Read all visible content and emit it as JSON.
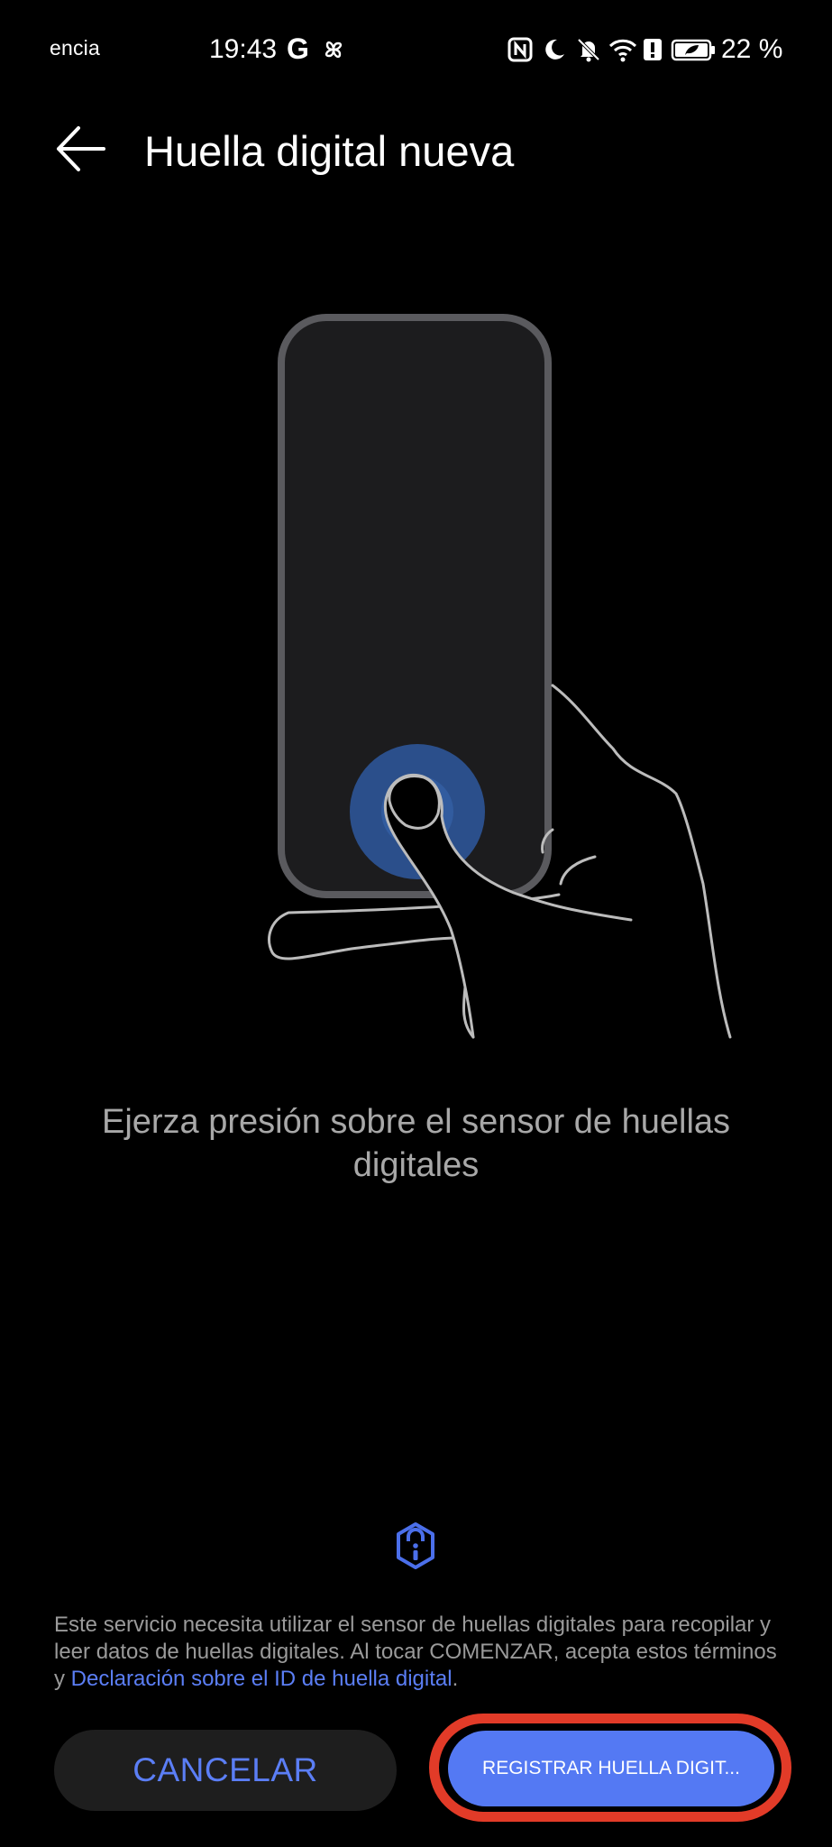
{
  "status_bar": {
    "left_text": "encia",
    "time": "19:43",
    "g_label": "G",
    "battery_percent": "22 %"
  },
  "header": {
    "title": "Huella digital nueva"
  },
  "instruction": {
    "text": "Ejerza presión sobre el sensor de huellas digitales"
  },
  "terms": {
    "text": "Este servicio necesita utilizar el sensor de huellas digitales para recopilar y leer datos de huellas digitales. Al tocar COMENZAR, acepta estos términos y ",
    "link_text": "Declaración sobre el ID de huella digital",
    "suffix": "."
  },
  "buttons": {
    "cancel_label": "CANCELAR",
    "register_label": "REGISTRAR HUELLA DIGIT..."
  },
  "colors": {
    "accent": "#5b7ef5",
    "highlight_ring": "#e23b28",
    "background": "#000000"
  },
  "icons": {
    "back": "arrow-left-icon",
    "info": "shield-info-icon"
  }
}
